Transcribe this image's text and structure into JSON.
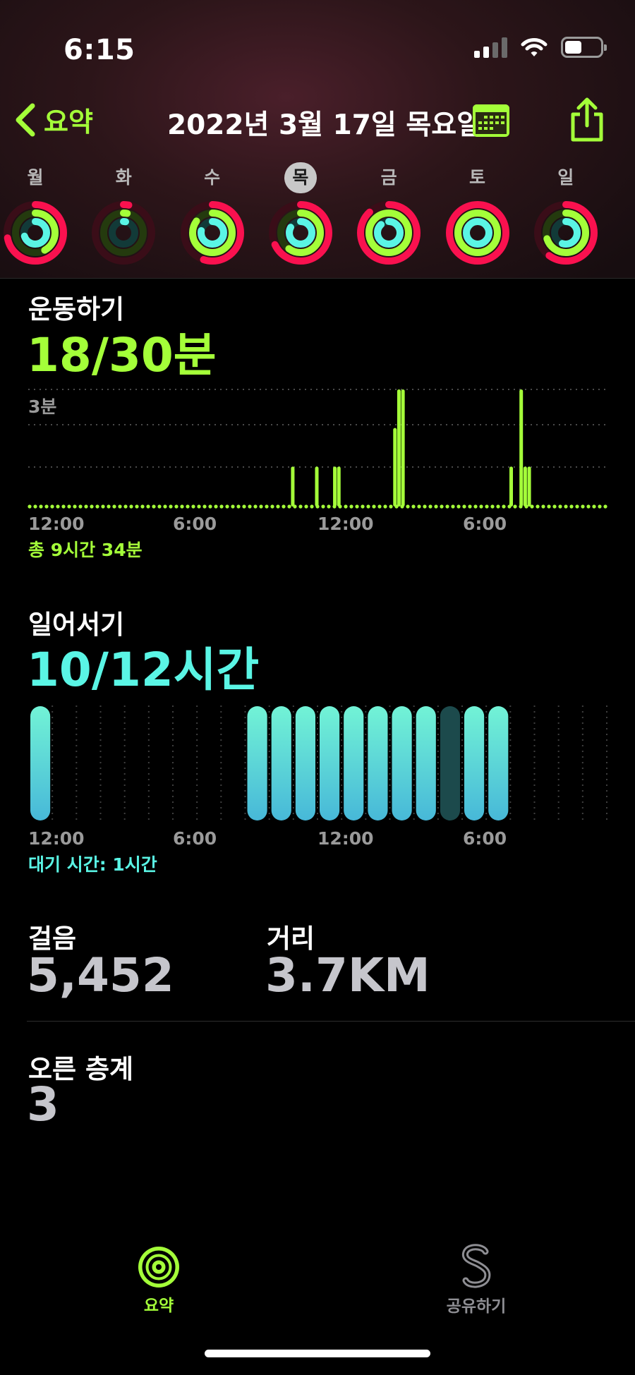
{
  "status": {
    "time": "6:15",
    "battery_level": 0.48
  },
  "nav": {
    "back_label": "요약",
    "title": "2022년 3월 17일 목요일",
    "calendar_icon": "calendar-icon",
    "share_icon": "share-icon"
  },
  "week": {
    "days": [
      {
        "label": "월",
        "selected": false,
        "move": 0.72,
        "exercise": 0.42,
        "stand": 0.7
      },
      {
        "label": "화",
        "selected": false,
        "move": 0.03,
        "exercise": 0.03,
        "stand": 0.03
      },
      {
        "label": "수",
        "selected": false,
        "move": 0.55,
        "exercise": 0.85,
        "stand": 0.78
      },
      {
        "label": "목",
        "selected": true,
        "move": 0.68,
        "exercise": 0.6,
        "stand": 0.83
      },
      {
        "label": "금",
        "selected": false,
        "move": 0.88,
        "exercise": 1.0,
        "stand": 0.88
      },
      {
        "label": "토",
        "selected": false,
        "move": 1.0,
        "exercise": 1.0,
        "stand": 1.0
      },
      {
        "label": "일",
        "selected": false,
        "move": 0.6,
        "exercise": 0.7,
        "stand": 0.55
      }
    ]
  },
  "exercise": {
    "label": "운동하기",
    "value": "18/30분",
    "ymax_label": "3분",
    "x_labels": [
      "12:00",
      "6:00",
      "12:00",
      "6:00"
    ],
    "total": "총 9시간 34분"
  },
  "stand": {
    "label": "일어서기",
    "value": "10/12시간",
    "x_labels": [
      "12:00",
      "6:00",
      "12:00",
      "6:00"
    ],
    "idle": "대기 시간: 1시간"
  },
  "steps": {
    "label": "걸음",
    "value": "5,452"
  },
  "distance": {
    "label": "거리",
    "value": "3.7KM"
  },
  "floors": {
    "label": "오른 층계",
    "value": "3"
  },
  "tabs": [
    {
      "label": "요약",
      "icon": "activity-rings-icon",
      "active": true
    },
    {
      "label": "공유하기",
      "icon": "sharing-icon",
      "active": false
    }
  ],
  "colors": {
    "move": "#fa114f",
    "exercise": "#a4ff39",
    "stand": "#5af5e5",
    "accent": "#a4ff39"
  },
  "chart_data": [
    {
      "type": "bar",
      "title": "운동하기",
      "ylabel": "",
      "ylim": [
        0,
        3
      ],
      "x_unit": "minutes since 12:00 AM",
      "x": [
        660,
        720,
        765,
        775,
        915,
        925,
        935,
        1205,
        1230,
        1240,
        1250
      ],
      "values": [
        1,
        1,
        1,
        1,
        2,
        3,
        3,
        1,
        3,
        1,
        1
      ]
    },
    {
      "type": "bar",
      "title": "일어서기",
      "ylabel": "",
      "categories": [
        "0",
        "1",
        "2",
        "3",
        "4",
        "5",
        "6",
        "7",
        "8",
        "9",
        "10",
        "11",
        "12",
        "13",
        "14",
        "15",
        "16",
        "17",
        "18",
        "19",
        "20",
        "21",
        "22",
        "23"
      ],
      "values": [
        1,
        0,
        0,
        0,
        0,
        0,
        0,
        0,
        0,
        1,
        1,
        1,
        1,
        1,
        1,
        1,
        1,
        0.5,
        1,
        1,
        0,
        0,
        0,
        0
      ]
    }
  ]
}
